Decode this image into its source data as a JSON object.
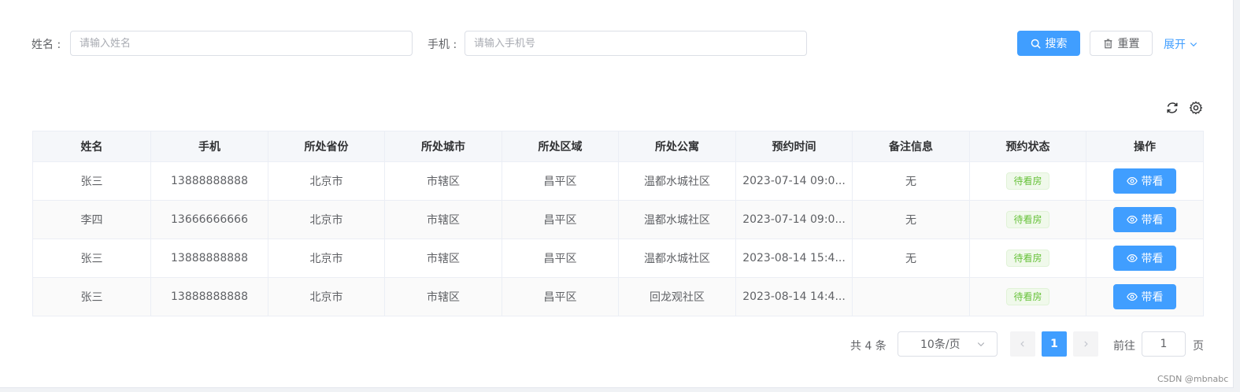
{
  "search": {
    "name_label": "姓名 :",
    "name_placeholder": "请输入姓名",
    "phone_label": "手机 :",
    "phone_placeholder": "请输入手机号",
    "search_button": "搜索",
    "reset_button": "重置",
    "expand_link": "展开"
  },
  "table": {
    "columns": [
      "姓名",
      "手机",
      "所处省份",
      "所处城市",
      "所处区域",
      "所处公寓",
      "预约时间",
      "备注信息",
      "预约状态",
      "操作"
    ],
    "rows": [
      {
        "name": "张三",
        "phone": "13888888888",
        "province": "北京市",
        "city": "市辖区",
        "district": "昌平区",
        "apartment": "温都水城社区",
        "time": "2023-07-14 09:0...",
        "remark": "无",
        "status": "待看房",
        "action": "带看"
      },
      {
        "name": "李四",
        "phone": "13666666666",
        "province": "北京市",
        "city": "市辖区",
        "district": "昌平区",
        "apartment": "温都水城社区",
        "time": "2023-07-14 09:0...",
        "remark": "无",
        "status": "待看房",
        "action": "带看"
      },
      {
        "name": "张三",
        "phone": "13888888888",
        "province": "北京市",
        "city": "市辖区",
        "district": "昌平区",
        "apartment": "温都水城社区",
        "time": "2023-08-14 15:4...",
        "remark": "无",
        "status": "待看房",
        "action": "带看"
      },
      {
        "name": "张三",
        "phone": "13888888888",
        "province": "北京市",
        "city": "市辖区",
        "district": "昌平区",
        "apartment": "回龙观社区",
        "time": "2023-08-14 14:4...",
        "remark": "",
        "status": "待看房",
        "action": "带看"
      }
    ]
  },
  "pagination": {
    "total": "共 4 条",
    "page_size": "10条/页",
    "current_page": "1",
    "goto_label": "前往",
    "goto_value": "1",
    "page_suffix": "页"
  },
  "watermark": "CSDN @mbnabc",
  "colors": {
    "primary": "#409eff",
    "status_tag_text": "#67c23a",
    "header_bg": "#f5f7fa"
  }
}
